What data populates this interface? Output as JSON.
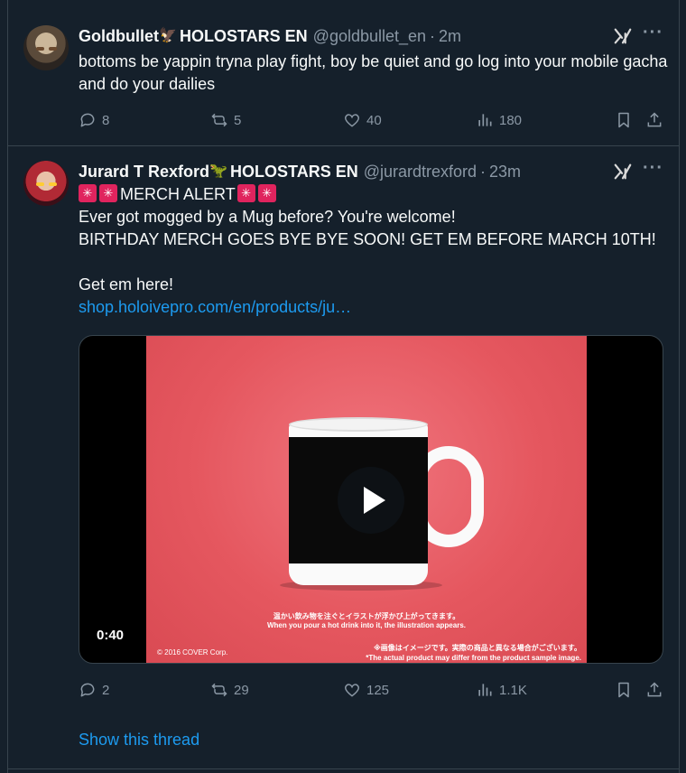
{
  "tweets": [
    {
      "display_name": "Goldbullet",
      "name_emoji": "🦅",
      "org": "HOLOSTARS EN",
      "handle": "@goldbullet_en",
      "separator": "·",
      "time": "2m",
      "text": "bottoms be yappin tryna play fight, boy be quiet and go log into your mobile gacha and do your dailies",
      "replies": "8",
      "retweets": "5",
      "likes": "40",
      "views": "180"
    },
    {
      "display_name": "Jurard T Rexford",
      "name_emoji": "🦖",
      "org": "HOLOSTARS EN",
      "handle": "@jurardtrexford",
      "separator": "·",
      "time": "23m",
      "lines": [
        "MERCH ALERT",
        "Ever got mogged by a Mug before? You're welcome!",
        "BIRTHDAY MERCH GOES BYE BYE SOON! GET EM BEFORE MARCH 10TH!",
        "Get em here!"
      ],
      "link": "shop.holoivepro.com/en/products/ju…",
      "media": {
        "caption_jp": "温かい飲み物を注ぐとイラストが浮かび上がってきます。",
        "caption_en": "When you pour a hot drink into it, the illustration appears.",
        "copyright": "© 2016 COVER Corp.",
        "disclaimer_jp": "※画像はイメージです。実際の商品と異なる場合がございます。",
        "disclaimer_en": "*The actual product may differ from the product sample image.",
        "duration": "0:40"
      },
      "replies": "2",
      "retweets": "29",
      "likes": "125",
      "views": "1.1K",
      "show_thread": "Show this thread"
    }
  ],
  "icons": {
    "reply": "reply-icon",
    "retweet": "retweet-icon",
    "like": "heart-icon",
    "views": "views-icon",
    "bookmark": "bookmark-icon",
    "share": "share-icon",
    "grok": "grok-icon",
    "more": "more-icon"
  },
  "colors": {
    "background": "#15202b",
    "accent": "#1d9bf0",
    "muted": "#8b98a5"
  }
}
